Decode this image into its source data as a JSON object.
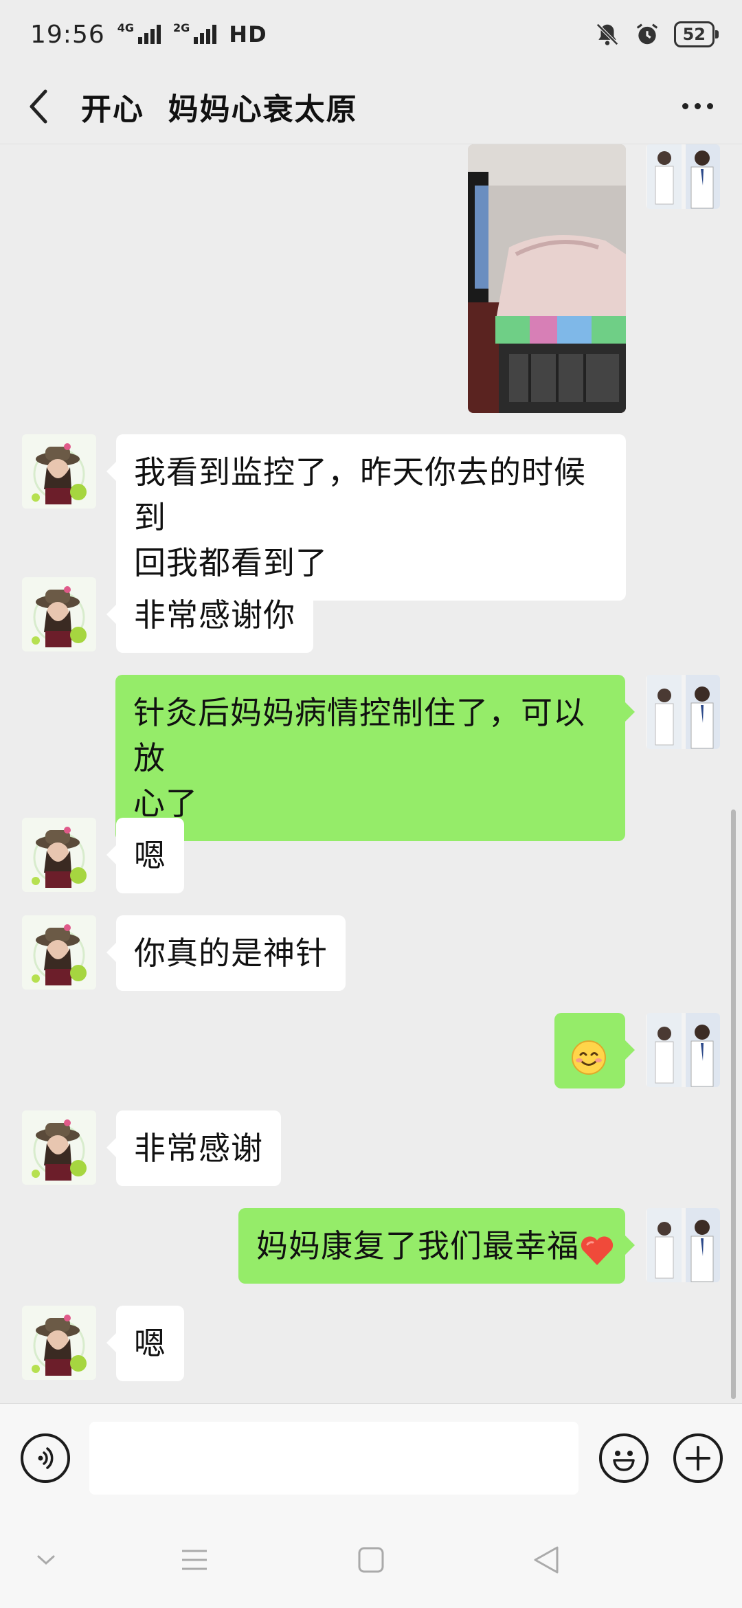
{
  "status_bar": {
    "time": "19:56",
    "network_1": "4G",
    "network_2": "2G",
    "hd_label": "HD",
    "battery": "52"
  },
  "header": {
    "title": "开心  妈妈心衰太原",
    "back_icon": "chevron-left-icon",
    "more_icon": "more-dots-icon"
  },
  "messages": [
    {
      "id": "m0",
      "side": "out",
      "type": "image",
      "alt": "bedroom-photo"
    },
    {
      "id": "m1",
      "side": "in",
      "type": "text",
      "lines": [
        "我看到监控了，昨天你去的时候到",
        "回我都看到了"
      ]
    },
    {
      "id": "m2",
      "side": "in",
      "type": "text",
      "lines": [
        "非常感谢你"
      ]
    },
    {
      "id": "m3",
      "side": "out",
      "type": "text",
      "lines": [
        "针灸后妈妈病情控制住了，可以放",
        "心了"
      ]
    },
    {
      "id": "m4",
      "side": "in",
      "type": "text",
      "lines": [
        "嗯"
      ]
    },
    {
      "id": "m5",
      "side": "in",
      "type": "text",
      "lines": [
        "你真的是神针"
      ]
    },
    {
      "id": "m6",
      "side": "out",
      "type": "emoji",
      "emoji": "smiling-face-icon"
    },
    {
      "id": "m7",
      "side": "in",
      "type": "text",
      "lines": [
        "非常感谢"
      ]
    },
    {
      "id": "m8",
      "side": "out",
      "type": "text",
      "lines": [
        "妈妈康复了我们最幸福"
      ],
      "trailing_emoji": "red-heart-icon"
    },
    {
      "id": "m9",
      "side": "in",
      "type": "text",
      "lines": [
        "嗯"
      ]
    }
  ],
  "input_bar": {
    "placeholder": "",
    "value": "",
    "voice_icon": "voice-icon",
    "emoji_icon": "emoji-icon",
    "plus_icon": "plus-icon"
  },
  "nav_bar": {
    "buttons": [
      "collapse-icon",
      "menu-icon",
      "home-icon",
      "back-triangle-icon"
    ]
  },
  "colors": {
    "background": "#ededed",
    "bubble_out": "#95ec69",
    "bubble_in": "#ffffff"
  }
}
